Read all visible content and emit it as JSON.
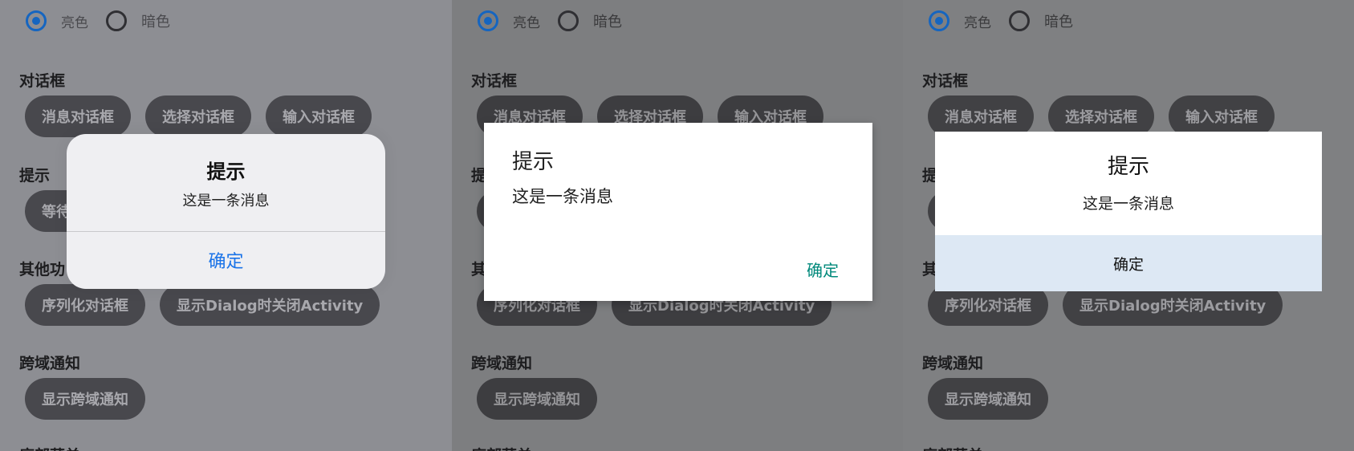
{
  "theme": {
    "light_label": "亮色",
    "dark_label": "暗色"
  },
  "sections": {
    "dialog": "对话框",
    "tips": "提示",
    "other": "其他功",
    "cross": "跨域通知",
    "bottom": "底部菜单"
  },
  "buttons": {
    "message": "消息对话框",
    "select": "选择对话框",
    "input": "输入对话框",
    "wait": "等待",
    "serialize": "序列化对话框",
    "close_activity": "显示Dialog时关闭Activity",
    "cross_notify": "显示跨域通知"
  },
  "dialog": {
    "title": "提示",
    "message": "这是一条消息",
    "ok": "确定"
  }
}
